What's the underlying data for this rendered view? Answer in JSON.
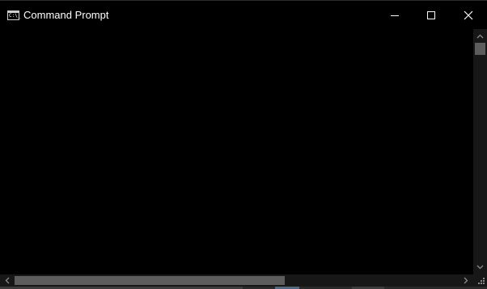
{
  "window": {
    "title": "Command Prompt",
    "app_icon_glyph": "C:\\_",
    "app_icon": "cmd-icon",
    "controls": {
      "minimize": "minimize-icon",
      "maximize": "maximize-icon",
      "close": "close-icon"
    }
  },
  "console": {
    "text": ""
  },
  "scrollbars": {
    "vertical": {
      "up_icon": "chevron-up-icon",
      "down_icon": "chevron-down-icon"
    },
    "horizontal": {
      "left_icon": "chevron-left-icon",
      "right_icon": "chevron-right-icon"
    }
  },
  "colors": {
    "background": "#000000",
    "foreground": "#ffffff",
    "scrollbar_track": "#171717",
    "scrollbar_thumb": "#5d5d5d"
  }
}
